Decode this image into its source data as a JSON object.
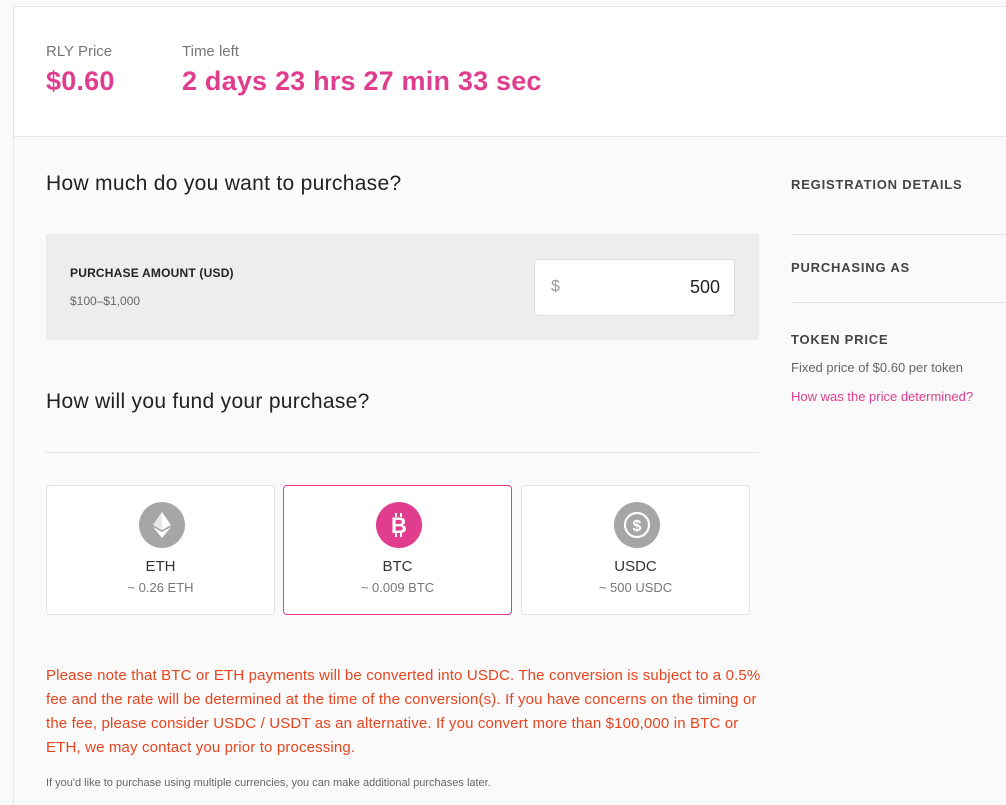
{
  "header": {
    "price_label": "RLY Price",
    "price_value": "$0.60",
    "time_label": "Time left",
    "time_value": "2 days 23 hrs 27 min 33 sec"
  },
  "purchase": {
    "question": "How much do you want to purchase?",
    "amount_title": "PURCHASE AMOUNT (USD)",
    "amount_range": "$100–$1,000",
    "currency_symbol": "$",
    "amount_value": "500"
  },
  "funding": {
    "question": "How will you fund your purchase?",
    "options": [
      {
        "name": "ETH",
        "approx": "~ 0.26 ETH",
        "icon": "ethereum-icon",
        "selected": false
      },
      {
        "name": "BTC",
        "approx": "~ 0.009 BTC",
        "icon": "bitcoin-icon",
        "selected": true
      },
      {
        "name": "USDC",
        "approx": "~ 500 USDC",
        "icon": "usdc-icon",
        "selected": false
      }
    ],
    "notice": "Please note that BTC or ETH payments will be converted into USDC. The conversion is subject to a 0.5% fee and the rate will be determined at the time of the conversion(s). If you have concerns on the timing or the fee, please consider USDC / USDT as an alternative. If you convert more than $100,000 in BTC or ETH, we may contact you prior to processing.",
    "footnote": "If you'd like to purchase using multiple currencies, you can make additional purchases later."
  },
  "sidebar": {
    "registration_heading": "REGISTRATION DETAILS",
    "purchasing_as_heading": "PURCHASING AS",
    "token_price_heading": "TOKEN PRICE",
    "token_price_text": "Fixed price of $0.60 per token",
    "price_link": "How was the price determined?"
  },
  "colors": {
    "accent": "#e03d8f",
    "warning": "#e8441f",
    "icon_gray": "#a6a6a6"
  }
}
